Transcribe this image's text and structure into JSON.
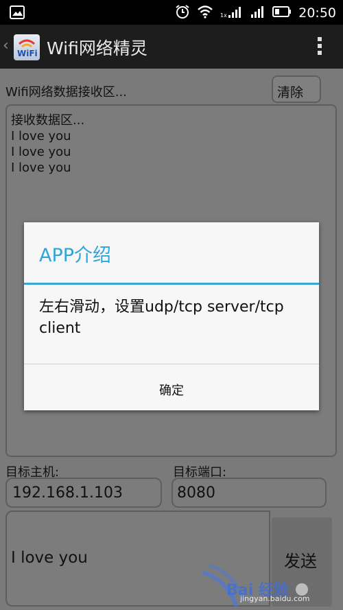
{
  "status_bar": {
    "time": "20:50",
    "icons": [
      "image-notification-icon",
      "alarm-icon",
      "wifi-icon",
      "signal-1x-icon",
      "signal-icon",
      "battery-icon"
    ]
  },
  "action_bar": {
    "title": "Wifi网络精灵",
    "logo_text": "WiFi"
  },
  "receive": {
    "caption": "Wifi网络数据接收区...",
    "clear_button": "清除",
    "lines": [
      "接收数据区...",
      "I love you",
      "I love you",
      "I love you"
    ]
  },
  "target": {
    "host_label": "目标主机:",
    "host_value": "192.168.1.103",
    "port_label": "目标端口:",
    "port_value": "8080"
  },
  "send": {
    "text": "I love you",
    "button": "发送"
  },
  "dialog": {
    "title": "APP介绍",
    "message": "左右滑动，设置udp/tcp server/tcp client",
    "ok_button": "确定"
  },
  "watermark": {
    "text": "Bai 经验",
    "sub": "jingyan.baidu.com"
  },
  "colors": {
    "dialog_accent": "#35a7db",
    "dim_background": "#7a7a7a"
  }
}
